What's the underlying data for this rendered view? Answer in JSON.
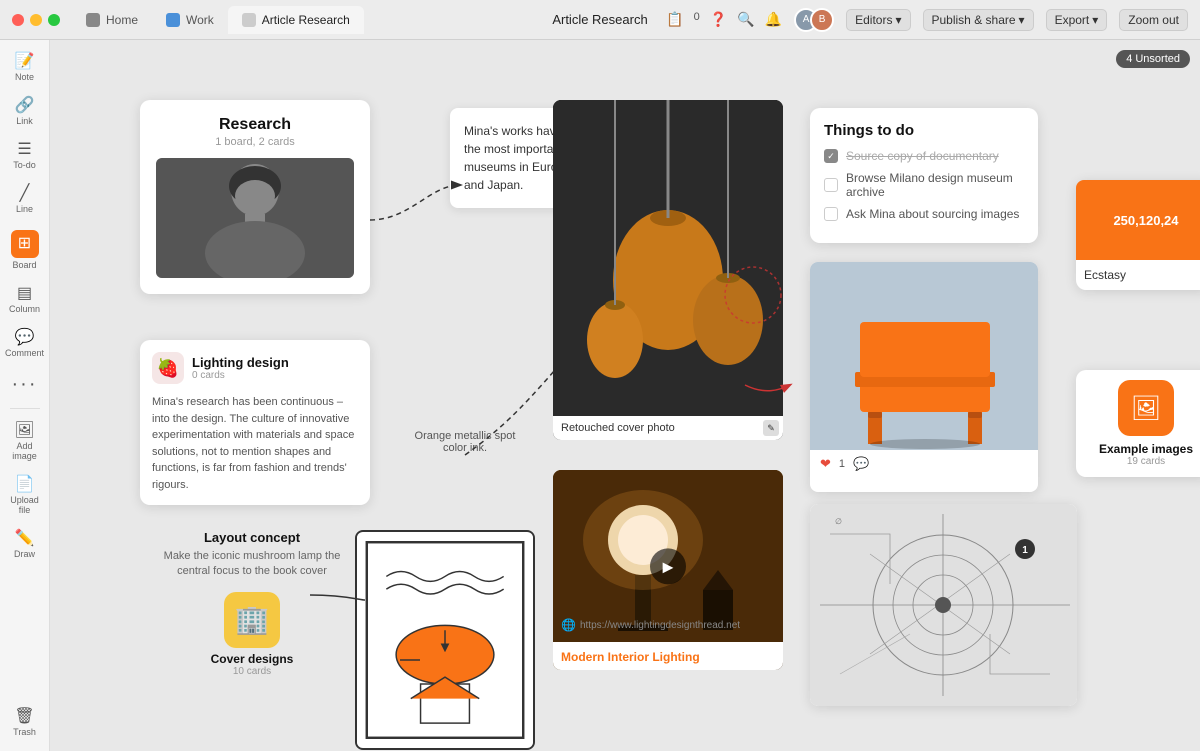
{
  "titlebar": {
    "title": "Article Research",
    "tabs": [
      {
        "id": "home",
        "label": "Home",
        "icon_color": "#888888"
      },
      {
        "id": "work",
        "label": "Work",
        "icon_color": "#4a90d9"
      },
      {
        "id": "article",
        "label": "Article Research",
        "icon_color": "#cccccc",
        "active": true
      }
    ],
    "editors_label": "Editors",
    "publish_label": "Publish & share",
    "export_label": "Export",
    "zoomout_label": "Zoom out",
    "unsorted_label": "4 Unsorted"
  },
  "sidebar": {
    "items": [
      {
        "id": "note",
        "label": "Note",
        "icon": "📝"
      },
      {
        "id": "link",
        "label": "Link",
        "icon": "🔗"
      },
      {
        "id": "todo",
        "label": "To-do",
        "icon": "☰"
      },
      {
        "id": "line",
        "label": "Line",
        "icon": "╱"
      },
      {
        "id": "board",
        "label": "Board",
        "icon": "⊞",
        "active": true
      },
      {
        "id": "column",
        "label": "Column",
        "icon": "▤"
      },
      {
        "id": "comment",
        "label": "Comment",
        "icon": "💬"
      },
      {
        "id": "more",
        "label": "",
        "icon": "···"
      },
      {
        "id": "addimage",
        "label": "Add image",
        "icon": "🖼"
      },
      {
        "id": "uploadfile",
        "label": "Upload file",
        "icon": "📄"
      },
      {
        "id": "draw",
        "label": "Draw",
        "icon": "✏️"
      },
      {
        "id": "trash",
        "label": "Trash",
        "icon": "🗑"
      }
    ]
  },
  "research_card": {
    "title": "Research",
    "subtitle": "1 board, 2 cards"
  },
  "lighting_card": {
    "title": "Lighting design",
    "subtitle": "0 cards",
    "description": "Mina's research has been continuous – into the design. The culture of innovative experimentation with materials and space solutions, not to mention shapes and functions, is far from fashion and trends' rigours."
  },
  "callout": {
    "text": "Mina's works have been shown in the most important international museums in Europe, USA, Australia and Japan."
  },
  "orange_label": {
    "text": "Orange metallic spot color ink."
  },
  "layout_concept": {
    "title": "Layout concept",
    "description": "Make the iconic mushroom lamp the central focus to the book cover"
  },
  "cover_design": {
    "label": "Cover designs",
    "count": "10 cards"
  },
  "lamp_photo": {
    "caption": "Retouched cover photo"
  },
  "interior_link": {
    "url": "https://www.lightingdesignthread.net",
    "title": "Modern Interior Lighting"
  },
  "todo": {
    "title": "Things to do",
    "items": [
      {
        "text": "Source copy of documentary",
        "done": true
      },
      {
        "text": "Browse Milano design museum archive",
        "done": false
      },
      {
        "text": "Ask Mina about sourcing images",
        "done": false
      }
    ]
  },
  "swatch": {
    "color_value": "250,120,24",
    "color_hex": "#f97316",
    "label": "Ecstasy"
  },
  "example_images": {
    "title": "Example images",
    "count": "19 cards"
  }
}
